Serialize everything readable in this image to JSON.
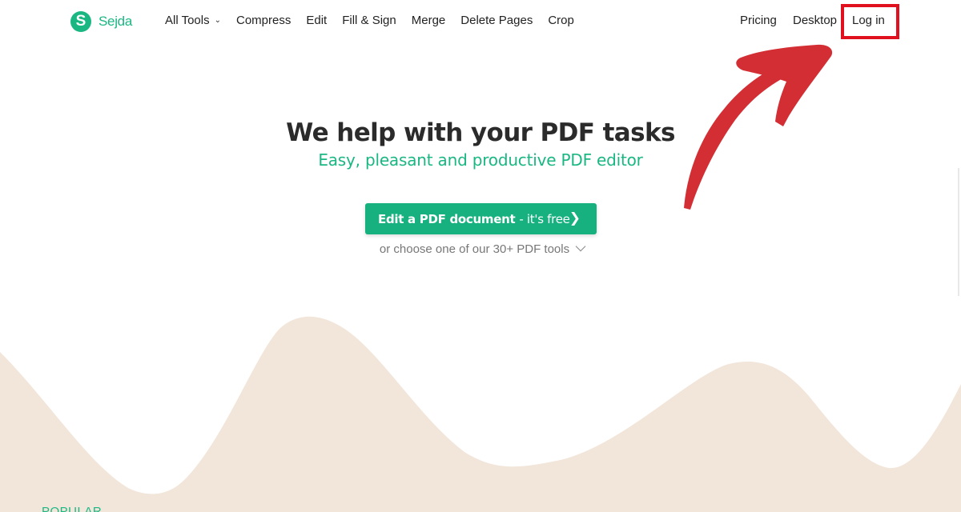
{
  "brand": {
    "logo_letter": "S",
    "name": "Sejda"
  },
  "nav": {
    "left": [
      {
        "label": "All Tools",
        "has_caret": true
      },
      {
        "label": "Compress"
      },
      {
        "label": "Edit"
      },
      {
        "label": "Fill & Sign"
      },
      {
        "label": "Merge"
      },
      {
        "label": "Delete Pages"
      },
      {
        "label": "Crop"
      }
    ],
    "right": [
      {
        "label": "Pricing"
      },
      {
        "label": "Desktop"
      },
      {
        "label": "Log in",
        "highlighted": true
      }
    ],
    "caret_icon": "chevron-down-icon"
  },
  "hero": {
    "title": "We help with your PDF tasks",
    "subtitle": "Easy, pleasant and productive PDF editor"
  },
  "cta": {
    "strong": "Edit a PDF document",
    "light": "- it's free",
    "icon": "chevron-right-icon"
  },
  "more_tools": {
    "label": "or choose one of our 30+ PDF tools",
    "icon": "chevron-down-icon"
  },
  "section": {
    "label": "POPULAR"
  },
  "annotation": {
    "highlight_color": "#e0101f",
    "arrow_color": "#d22e34",
    "target": "Log in"
  },
  "colors": {
    "brand": "#1bb783",
    "wave": "#f2e5d9",
    "button": "#17b07f"
  }
}
